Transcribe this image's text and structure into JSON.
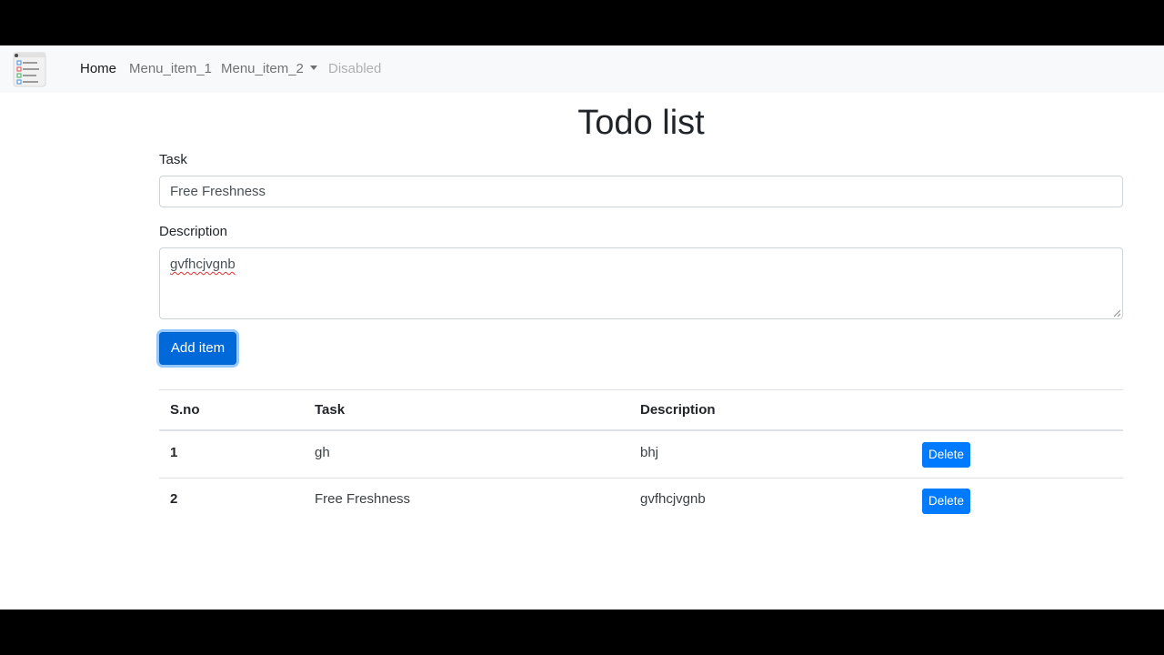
{
  "navbar": {
    "brand_icon": "todo-list-logo-icon",
    "links": [
      {
        "label": "Home"
      },
      {
        "label": "Menu_item_1"
      },
      {
        "label": "Menu_item_2"
      },
      {
        "label": "Disabled"
      }
    ]
  },
  "main": {
    "title": "Todo list",
    "task_label": "Task",
    "task_value": "Free Freshness",
    "description_label": "Description",
    "description_value": "gvfhcjvgnb",
    "add_button": "Add item"
  },
  "table": {
    "headers": [
      "S.no",
      "Task",
      "Description"
    ],
    "rows": [
      {
        "sno": "1",
        "task": "gh",
        "description": "bhj",
        "action": "Delete"
      },
      {
        "sno": "2",
        "task": "Free Freshness",
        "description": "gvfhcjvgnb",
        "action": "Delete"
      }
    ]
  },
  "colors": {
    "primary": "#007bff",
    "primary_active": "#0069d9",
    "navbar_bg": "#f8f9fa"
  }
}
